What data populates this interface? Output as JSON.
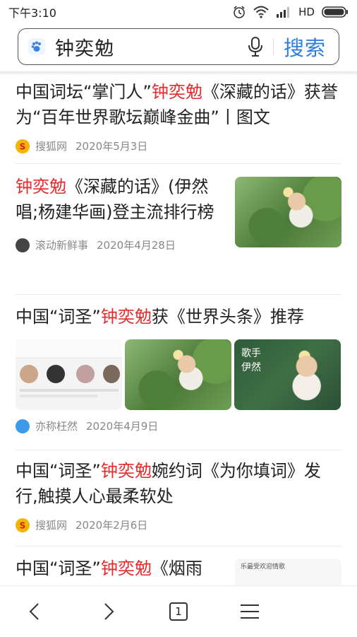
{
  "status_bar": {
    "time": "下午3:10",
    "network": "HD"
  },
  "search": {
    "query": "钟奕勉",
    "button_label": "搜索"
  },
  "feed": [
    {
      "title_parts": [
        "中国词坛“掌门人”",
        "钟奕勉",
        "《深藏的话》获誉为“百年世界歌坛巅峰金曲”丨图文"
      ],
      "source": "搜狐网",
      "date": "2020年5月3日"
    },
    {
      "title_parts": [
        "",
        "钟奕勉",
        "《深藏的话》(伊然唱;杨建华画)登主流排行榜"
      ],
      "source": "滚动新鲜事",
      "date": "2020年4月28日"
    },
    {
      "title_parts": [
        "中国“词圣”",
        "钟奕勉",
        "获《世界头条》推荐"
      ],
      "source": "亦称枉然",
      "date": "2020年4月9日",
      "thumb_text": "歌手 伊然"
    },
    {
      "title_parts": [
        "中国“词圣”",
        "钟奕勉",
        "婉约词《为你填词》发行,触摸人心最柔软处"
      ],
      "source": "搜狐网",
      "date": "2020年2月6日"
    },
    {
      "title_parts": [
        "中国“词圣”",
        "钟奕勉",
        "《烟雨"
      ],
      "thumb_text": "乐最受欢迎情歌"
    }
  ],
  "bottom_nav": {
    "tab_count": "1"
  },
  "colors": {
    "highlight": "#e52b2b",
    "accent": "#2f7de1"
  }
}
